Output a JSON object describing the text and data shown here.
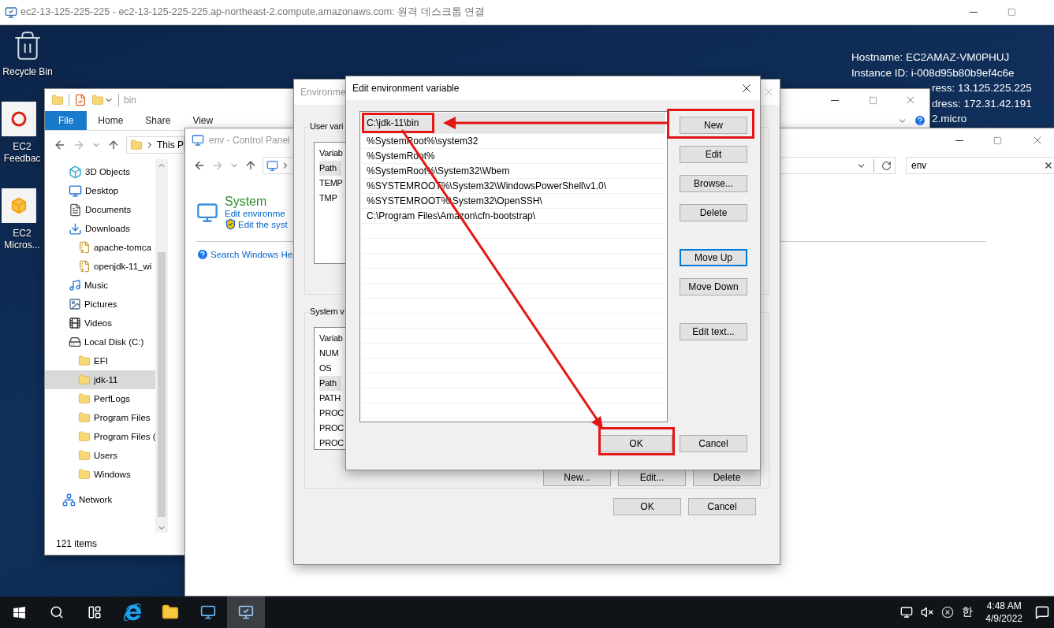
{
  "remote_window": {
    "title": "ec2-13-125-225-225 - ec2-13-125-225-225.ap-northeast-2.compute.amazonaws.com: 원격 데스크톱 연결"
  },
  "desktop": {
    "icons": [
      {
        "kind": "recycle",
        "label": "Recycle Bin"
      },
      {
        "kind": "feedback",
        "label": "EC2 Feedbac"
      },
      {
        "kind": "package",
        "label": "EC2 Micros..."
      }
    ],
    "info_lines": [
      "Hostname: EC2AMAZ-VM0PHUJ",
      "Instance ID: i-008d95b80b9ef4c6e"
    ],
    "info_fragments": [
      "ress: 13.125.225.225",
      "dress: 172.31.42.191",
      "2.micro"
    ]
  },
  "explorer": {
    "title": "bin",
    "ribbon_tabs": [
      {
        "label": "File",
        "selected": true
      },
      {
        "label": "Home",
        "selected": false
      },
      {
        "label": "Share",
        "selected": false
      },
      {
        "label": "View",
        "selected": false
      }
    ],
    "address": "This P",
    "nav": [
      {
        "kind": "cube",
        "label": "3D Objects",
        "selected": false
      },
      {
        "kind": "desktop",
        "label": "Desktop",
        "selected": false
      },
      {
        "kind": "documents",
        "label": "Documents",
        "selected": false
      },
      {
        "kind": "downloads",
        "label": "Downloads",
        "selected": false,
        "children": [
          {
            "kind": "zip",
            "label": "apache-tomca",
            "selected": false
          },
          {
            "kind": "zip",
            "label": "openjdk-11_wi",
            "selected": false
          }
        ]
      },
      {
        "kind": "music",
        "label": "Music",
        "selected": false
      },
      {
        "kind": "pictures",
        "label": "Pictures",
        "selected": false
      },
      {
        "kind": "videos",
        "label": "Videos",
        "selected": false
      },
      {
        "kind": "disk",
        "label": "Local Disk (C:)",
        "selected": false,
        "children": [
          {
            "kind": "folder",
            "label": "EFI",
            "selected": false
          },
          {
            "kind": "folder",
            "label": "jdk-11",
            "selected": true
          },
          {
            "kind": "folder",
            "label": "PerfLogs",
            "selected": false
          },
          {
            "kind": "folder",
            "label": "Program Files",
            "selected": false
          },
          {
            "kind": "folder",
            "label": "Program Files (",
            "selected": false
          },
          {
            "kind": "folder",
            "label": "Users",
            "selected": false
          },
          {
            "kind": "folder",
            "label": "Windows",
            "selected": false
          }
        ]
      },
      {
        "kind": "network",
        "label": "Network",
        "selected": false
      }
    ],
    "status": "121 items"
  },
  "control_panel": {
    "title": "env - Control Panel",
    "search": "env",
    "heading": "System",
    "links": [
      {
        "kind": "plain",
        "label": "Edit environme"
      },
      {
        "kind": "shield",
        "label": "Edit the syst"
      }
    ],
    "help_link": "Search Windows He"
  },
  "env_dialog": {
    "title": "Environme",
    "user_group": "User vari",
    "user_vars": {
      "header": "Variab",
      "rows": [
        {
          "name": "Path",
          "selected": true
        },
        {
          "name": "TEMP",
          "selected": false
        },
        {
          "name": "TMP",
          "selected": false
        }
      ]
    },
    "system_group": "System v",
    "system_vars": {
      "header": "Variab",
      "rows": [
        {
          "name": "NUM",
          "selected": false
        },
        {
          "name": "OS",
          "selected": false
        },
        {
          "name": "Path",
          "selected": true
        },
        {
          "name": "PATH",
          "selected": false
        },
        {
          "name": "PROC",
          "selected": false
        },
        {
          "name": "PROC",
          "selected": false
        },
        {
          "name": "PROC",
          "selected": false
        }
      ]
    },
    "list_buttons": [
      "New...",
      "Edit...",
      "Delete"
    ],
    "buttons": [
      "OK",
      "Cancel"
    ]
  },
  "edit_dialog": {
    "title": "Edit environment variable",
    "entries": [
      {
        "text": "C:\\jdk-11\\bin",
        "selected": true,
        "highlighted": true
      },
      {
        "text": "%SystemRoot%\\system32",
        "selected": false,
        "highlighted": false
      },
      {
        "text": "%SystemRoot%",
        "selected": false,
        "highlighted": false
      },
      {
        "text": "%SystemRoot%\\System32\\Wbem",
        "selected": false,
        "highlighted": false
      },
      {
        "text": "%SYSTEMROOT%\\System32\\WindowsPowerShell\\v1.0\\",
        "selected": false,
        "highlighted": false
      },
      {
        "text": "%SYSTEMROOT%\\System32\\OpenSSH\\",
        "selected": false,
        "highlighted": false
      },
      {
        "text": "C:\\Program Files\\Amazon\\cfn-bootstrap\\",
        "selected": false,
        "highlighted": false
      }
    ],
    "button_groups": [
      [
        {
          "label": "New",
          "focused": false,
          "highlighted": true
        },
        {
          "label": "Edit",
          "focused": false,
          "highlighted": false
        },
        {
          "label": "Browse...",
          "focused": false,
          "highlighted": false
        },
        {
          "label": "Delete",
          "focused": false,
          "highlighted": false
        }
      ],
      [
        {
          "label": "Move Up",
          "focused": true,
          "highlighted": false
        },
        {
          "label": "Move Down",
          "focused": false,
          "highlighted": false
        }
      ],
      [
        {
          "label": "Edit text...",
          "focused": false,
          "highlighted": false
        }
      ]
    ],
    "footer_buttons": [
      {
        "label": "OK",
        "highlighted": true
      },
      {
        "label": "Cancel",
        "highlighted": false
      }
    ]
  },
  "taskbar": {
    "apps": [
      {
        "kind": "start",
        "active": false
      },
      {
        "kind": "search",
        "active": false
      },
      {
        "kind": "taskview",
        "active": false
      },
      {
        "kind": "browser",
        "active": false
      },
      {
        "kind": "explorer",
        "active": false
      },
      {
        "kind": "controlpanel",
        "active": false
      },
      {
        "kind": "remote",
        "active": true
      }
    ],
    "tray": {
      "ime": "한",
      "time": "4:48 AM",
      "date": "4/9/2022"
    }
  }
}
